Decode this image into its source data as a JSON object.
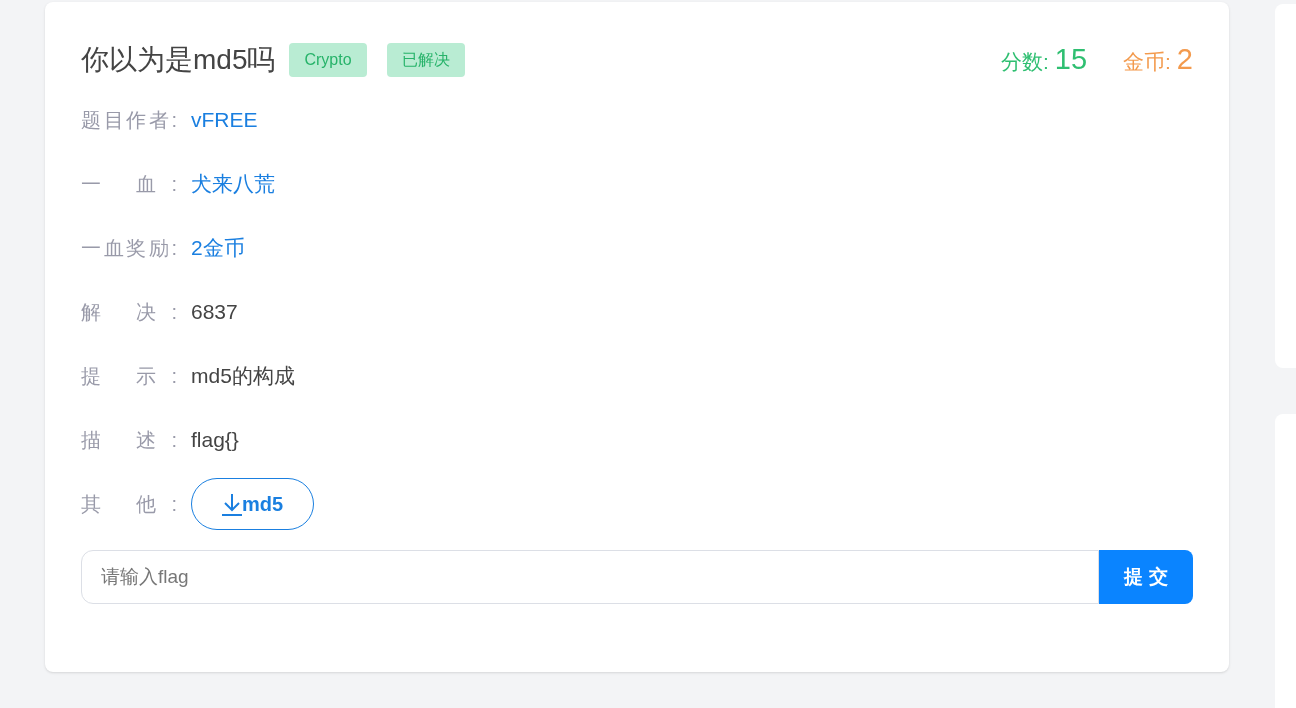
{
  "challenge": {
    "title": "你以为是md5吗",
    "tags": [
      {
        "label": "Crypto"
      },
      {
        "label": "已解决"
      }
    ],
    "score": {
      "label": "分数:",
      "value": "15"
    },
    "coins": {
      "label": "金币:",
      "value": "2"
    },
    "fields": [
      {
        "label": "题目作者:",
        "value": "vFREE",
        "kind": "link"
      },
      {
        "label": "一 血:",
        "value": "犬来八荒",
        "kind": "link"
      },
      {
        "label": "一血奖励:",
        "value": "2金币",
        "kind": "link"
      },
      {
        "label": "解 决:",
        "value": "6837",
        "kind": "text"
      },
      {
        "label": "提 示:",
        "value": "md5的构成",
        "kind": "text"
      },
      {
        "label": "描 述:",
        "value": "flag{}",
        "kind": "text"
      },
      {
        "label": "其 他:",
        "value": "md5",
        "kind": "download"
      }
    ],
    "flag_input": {
      "placeholder": "请输入flag"
    },
    "submit": "提 交"
  }
}
